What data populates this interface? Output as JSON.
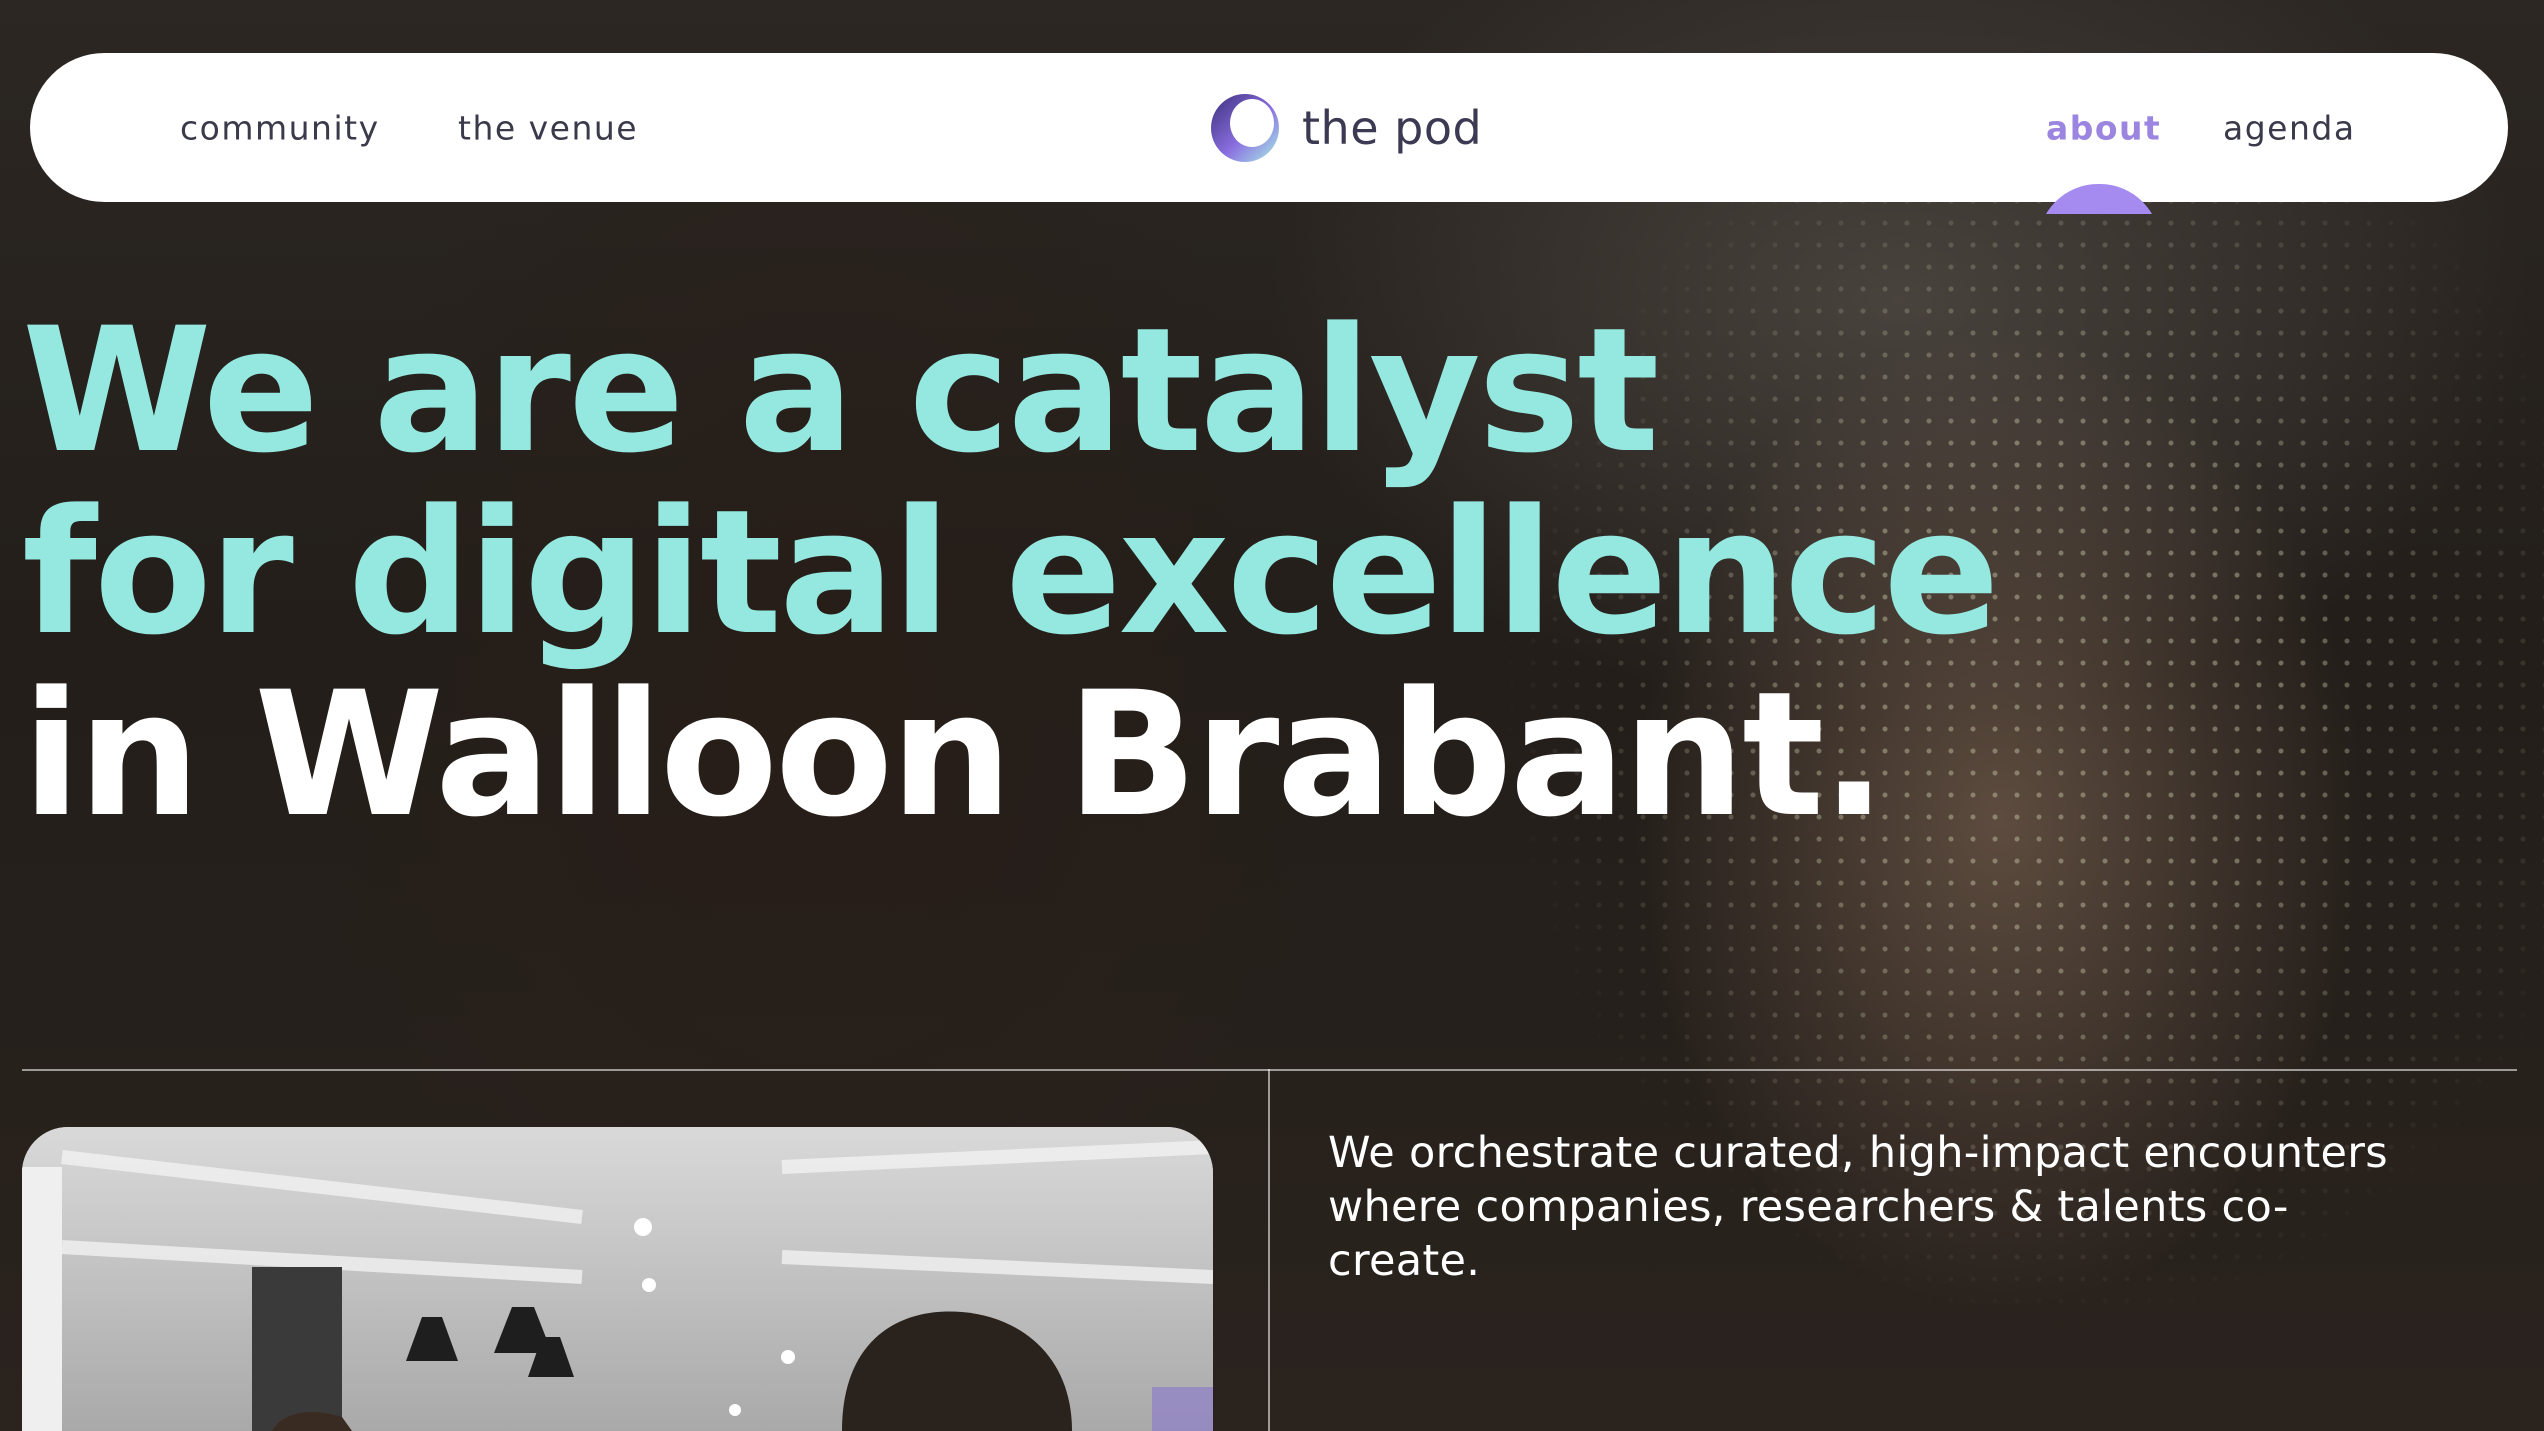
{
  "nav": {
    "left_links": [
      "community",
      "the venue"
    ],
    "right_links": [
      "about",
      "agenda"
    ],
    "active": "about"
  },
  "brand": {
    "name": "the pod",
    "logo_icon": "pod-ring-logo"
  },
  "hero": {
    "line1": "We are a catalyst",
    "line2": "for digital excellence",
    "line3": "in Walloon Brabant."
  },
  "intro": {
    "text": "We orchestrate curated, high-impact encounters where companies, researchers & talents co-create."
  },
  "colors": {
    "accent_mint": "#94e8df",
    "accent_purple": "#9b85e0",
    "text_dark": "#3a3a4a",
    "navbar_bg": "#ffffff"
  }
}
